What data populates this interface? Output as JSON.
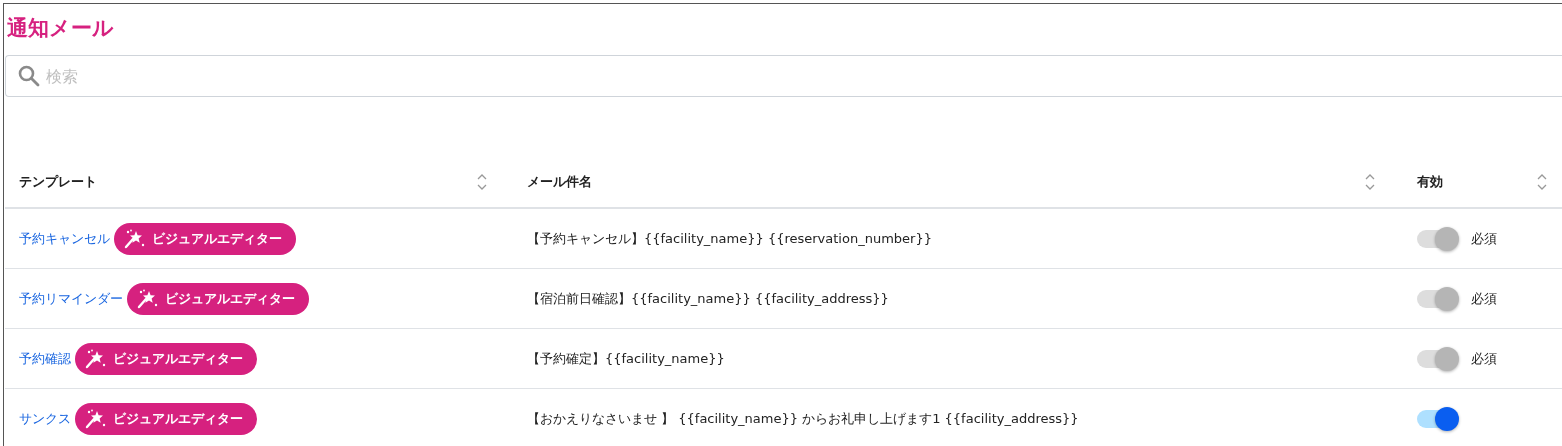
{
  "title": "通知メール",
  "search": {
    "placeholder": "検索"
  },
  "table": {
    "columns": [
      {
        "label": "テンプレート"
      },
      {
        "label": "メール件名"
      },
      {
        "label": "有効"
      }
    ],
    "rows": [
      {
        "template": "予約キャンセル",
        "editor_button": "ビジュアルエディター",
        "subject": "【予約キャンセル】{{facility_name}} {{reservation_number}}",
        "toggle": {
          "on": true,
          "disabled": true
        },
        "note": "必須"
      },
      {
        "template": "予約リマインダー",
        "editor_button": "ビジュアルエディター",
        "subject": "【宿泊前日確認】{{facility_name}} {{facility_address}}",
        "toggle": {
          "on": true,
          "disabled": true
        },
        "note": "必須"
      },
      {
        "template": "予約確認",
        "editor_button": "ビジュアルエディター",
        "subject": "【予約確定】{{facility_name}}",
        "toggle": {
          "on": true,
          "disabled": true
        },
        "note": "必須"
      },
      {
        "template": "サンクス",
        "editor_button": "ビジュアルエディター",
        "subject": "【おかえりなさいませ 】 {{facility_name}} からお礼申し上げます1 {{facility_address}}",
        "toggle": {
          "on": true,
          "disabled": false
        }
      }
    ]
  }
}
